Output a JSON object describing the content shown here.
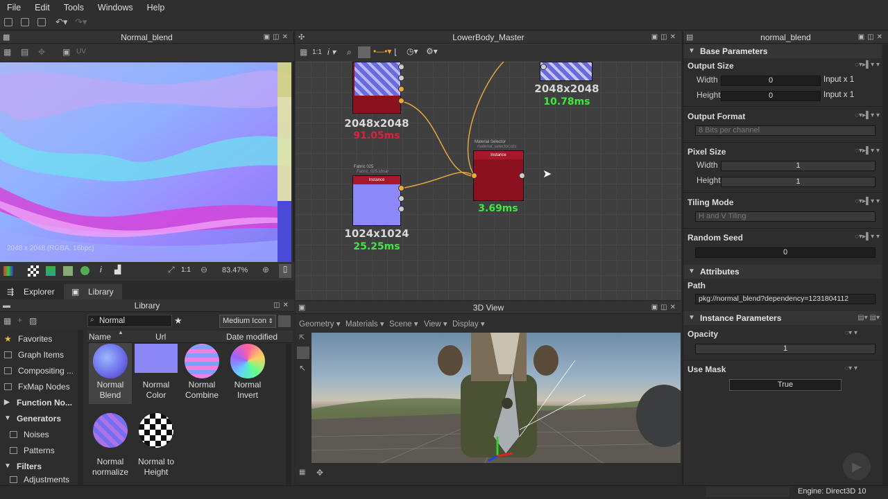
{
  "menu": [
    "File",
    "Edit",
    "Tools",
    "Windows",
    "Help"
  ],
  "view2d": {
    "title": "Normal_blend",
    "info": "2048 x 2048 (RGBA, 16bpc)",
    "zoom": "83.47%",
    "uv_label": "UV",
    "ratio": "1:1"
  },
  "graph": {
    "title": "LowerBody_Master",
    "ratio": "1:1",
    "nodes": [
      {
        "label": "Instance",
        "small_title": "Material Selector",
        "small_sub": "material_selector.sbs",
        "res": "",
        "ms": "3.69ms"
      },
      {
        "label": "Instance",
        "small_title": "Fabric 025",
        "small_sub": "Fabric_025.sbsar",
        "res": "1024x1024",
        "ms": "25.25ms"
      }
    ],
    "top_left": {
      "res": "2048x2048",
      "ms": "91.05ms"
    },
    "top_right": {
      "res": "2048x2048",
      "ms": "10.78ms"
    },
    "colors": {
      "ms_red": "#e0203a",
      "ms_green": "#3ee83e"
    }
  },
  "props": {
    "title": "normal_blend",
    "base_params": "Base Parameters",
    "output_size": {
      "label": "Output Size",
      "width_label": "Width",
      "width_value": "0",
      "width_suffix": "Input x 1",
      "height_label": "Height",
      "height_value": "0",
      "height_suffix": "Input x 1"
    },
    "output_format": {
      "label": "Output Format",
      "value": "8 Bits per channel"
    },
    "pixel_size": {
      "label": "Pixel Size",
      "width_label": "Width",
      "width_value": "1",
      "height_label": "Height",
      "height_value": "1"
    },
    "tiling_mode": {
      "label": "Tiling Mode",
      "value": "H and V Tiling"
    },
    "random_seed": {
      "label": "Random Seed",
      "value": "0"
    },
    "attributes": "Attributes",
    "path": {
      "label": "Path",
      "value": "pkg://normal_blend?dependency=1231804112"
    },
    "instance_params": "Instance Parameters",
    "opacity": {
      "label": "Opacity",
      "value": "1"
    },
    "use_mask": {
      "label": "Use Mask",
      "value": "True"
    }
  },
  "library": {
    "tab_explorer": "Explorer",
    "tab_library": "Library",
    "title": "Library",
    "search": "Normal",
    "view_mode": "Medium Icon",
    "columns": [
      "Name",
      "Url",
      "Date modified"
    ],
    "tree": [
      "Favorites",
      "Graph Items",
      "Compositing ...",
      "FxMap Nodes",
      "Function No...",
      "Generators",
      "Noises",
      "Patterns",
      "Filters",
      "Adjustments"
    ],
    "items": [
      {
        "line1": "Normal",
        "line2": "Blend"
      },
      {
        "line1": "Normal",
        "line2": "Color"
      },
      {
        "line1": "Normal",
        "line2": "Combine"
      },
      {
        "line1": "Normal",
        "line2": "Invert"
      },
      {
        "line1": "Normal",
        "line2": "normalize"
      },
      {
        "line1": "Normal to",
        "line2": "Height"
      }
    ]
  },
  "view3d": {
    "title": "3D View",
    "menus": [
      "Geometry",
      "Materials",
      "Scene",
      "View",
      "Display"
    ]
  },
  "status": {
    "engine": "Engine: Direct3D 10"
  }
}
